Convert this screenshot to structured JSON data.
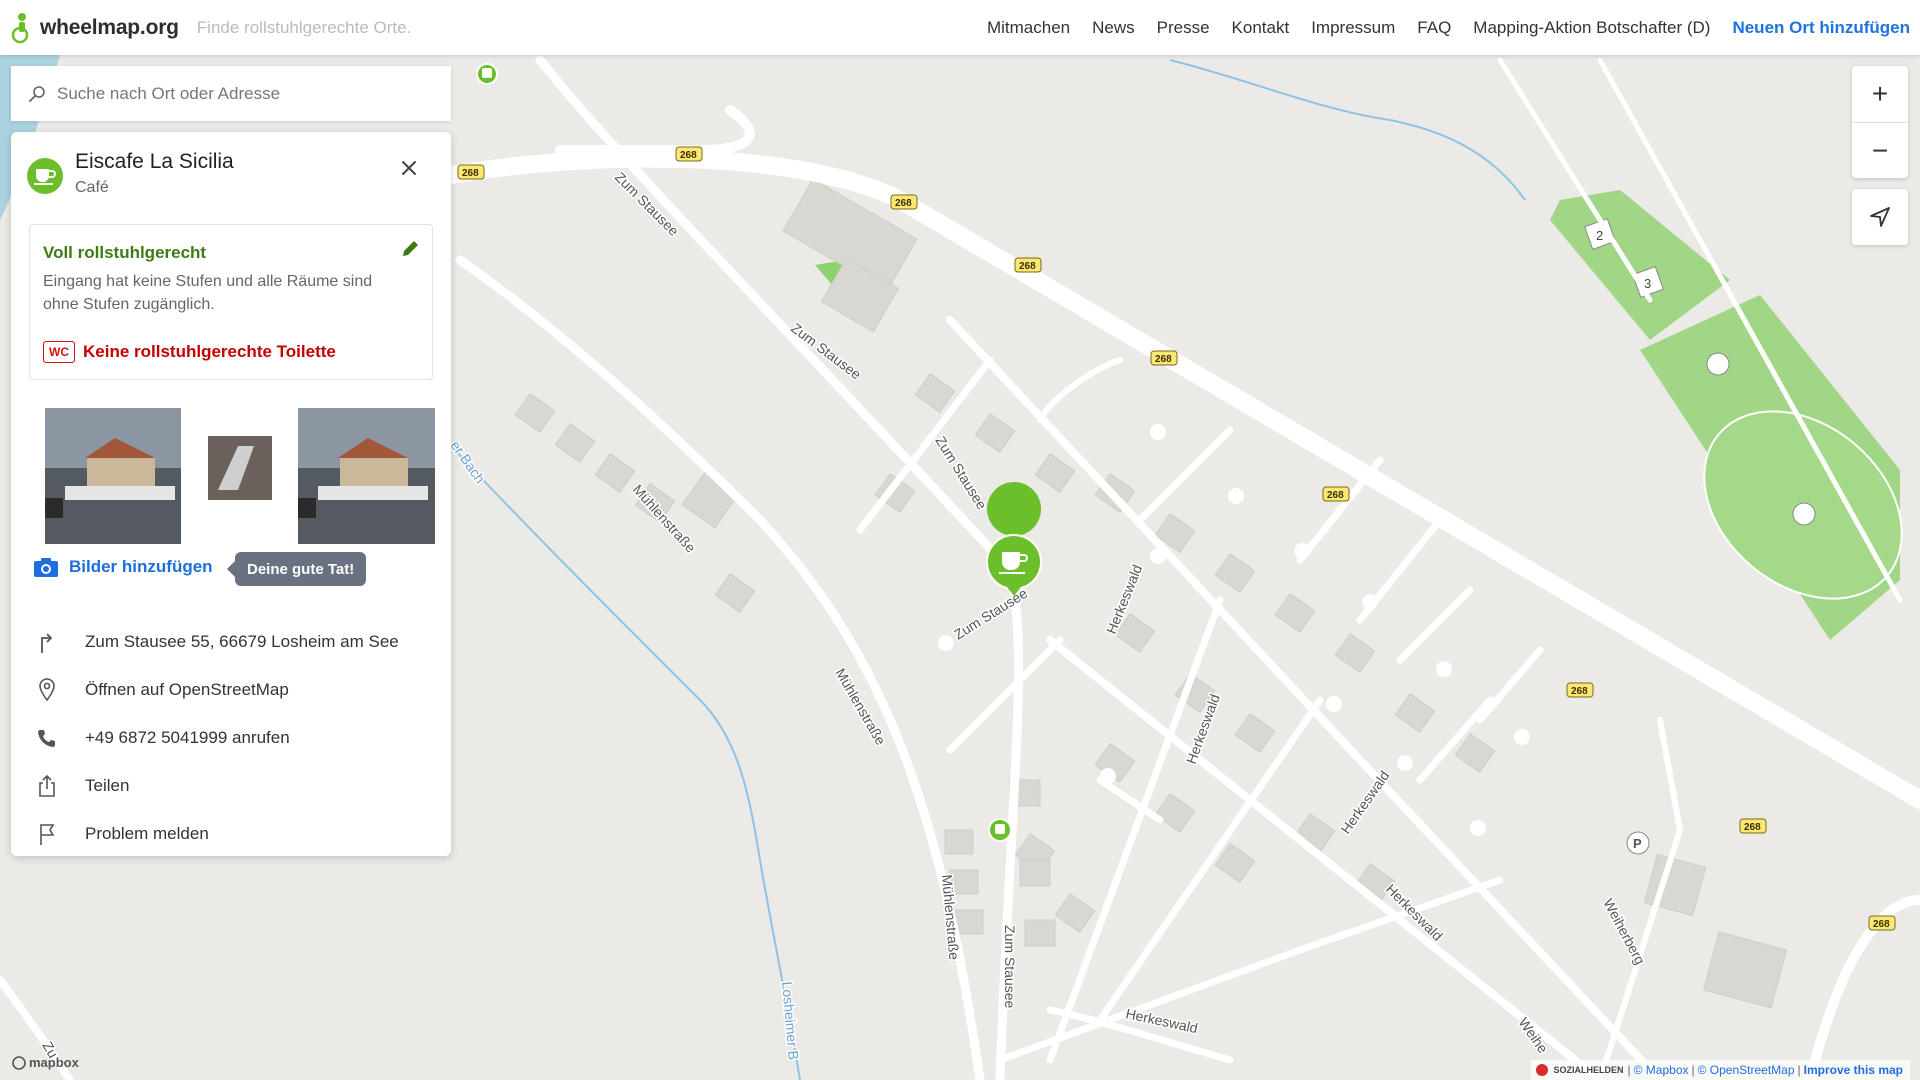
{
  "app": {
    "logo_text": "wheelmap.org",
    "claim": "Finde rollstuhlgerechte Orte."
  },
  "nav": {
    "items": [
      {
        "label": "Mitmachen"
      },
      {
        "label": "News"
      },
      {
        "label": "Presse"
      },
      {
        "label": "Kontakt"
      },
      {
        "label": "Impressum"
      },
      {
        "label": "FAQ"
      },
      {
        "label": "Mapping-Aktion Botschafter (D)"
      }
    ],
    "primary_label": "Neuen Ort hinzufügen"
  },
  "search": {
    "placeholder": "Suche nach Ort oder Adresse",
    "value": ""
  },
  "place": {
    "name": "Eiscafe La Sicilia",
    "category": "Café",
    "category_icon": "coffee-cup-icon",
    "accessibility": {
      "title": "Voll rollstuhlgerecht",
      "description": "Eingang hat keine Stufen und alle Räume sind ohne Stufen zugänglich.",
      "toilet_badge": "WC",
      "toilet_text": "Keine rollstuhlgerechte Toilette",
      "color_ok": "#3f7a12",
      "color_bad": "#c50000"
    },
    "add_photos_label": "Bilder hinzufügen",
    "tooltip": "Deine gute Tat!",
    "info": {
      "address": "Zum Stausee 55, 66679 Losheim am See",
      "osm": "Öffnen auf OpenStreetMap",
      "phone": "+49 6872 5041999 anrufen",
      "share": "Teilen",
      "report": "Problem melden"
    }
  },
  "map": {
    "zoom_in": "+",
    "zoom_out": "−",
    "road_labels": {
      "zum_stausee": "Zum Stausee",
      "muehlenstrasse": "Mühlenstraße",
      "herkeswald": "Herkeswald",
      "weiherberg": "Weiherberg",
      "weiher": "Weihe",
      "bach": "er Bach",
      "losheimer": "Losheimer B",
      "zu": "Zu"
    },
    "route_number": "268",
    "field_numbers": [
      "2",
      "3"
    ],
    "parking": "P",
    "mapbox": "mapbox",
    "accent_green": "#6bbf2a"
  },
  "attribution": {
    "sozialhelden": "SOZIALHELDEN",
    "mapbox": "© Mapbox",
    "osm": "© OpenStreetMap",
    "improve": "Improve this map"
  }
}
